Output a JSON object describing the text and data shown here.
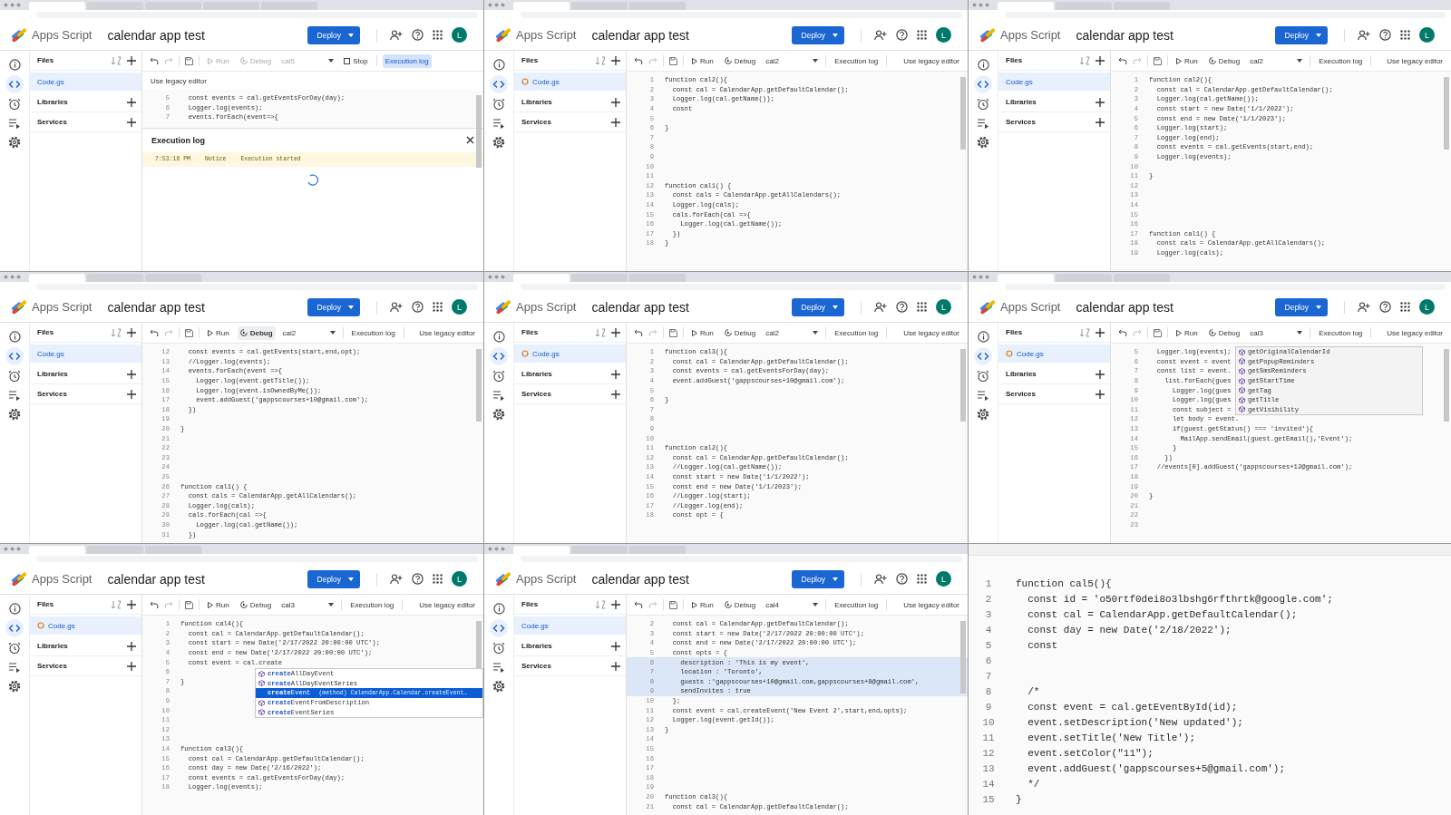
{
  "panels": [
    {
      "kind": "editor",
      "browser_tabs": [
        {
          "selected": true
        },
        {
          "selected": false
        },
        {
          "selected": false
        },
        {
          "selected": false
        },
        {
          "selected": false
        }
      ],
      "app_name": "Apps Script",
      "project": "calendar app test",
      "deploy": "Deploy",
      "avatar": "L",
      "files": {
        "title": "Files",
        "items": [
          {
            "name": "Code.gs",
            "selected": true,
            "unsaved": false
          }
        ],
        "sections": [
          "Libraries",
          "Services"
        ]
      },
      "toolbar": {
        "run": "Run",
        "run_disabled": true,
        "debug": "Debug",
        "debug_active": false,
        "function": "cal5",
        "stop": "Stop",
        "execution_log": "Execution log",
        "execution_log_selected": true,
        "legacy": "Use legacy editor"
      },
      "lines": [
        {
          "n": "5",
          "code": "  const events = cal.getEventsForDay(day);"
        },
        {
          "n": "6",
          "code": "  Logger.log(events);"
        },
        {
          "n": "7",
          "code": "  events.forEach(event=>{"
        }
      ],
      "exec_log": {
        "title": "Execution log",
        "rows": [
          {
            "time": "7:53:16 PM",
            "level": "Notice",
            "message": "Execution started"
          }
        ]
      }
    },
    {
      "kind": "editor",
      "browser_tabs": [
        {
          "selected": true
        },
        {
          "selected": false
        },
        {
          "selected": false
        }
      ],
      "app_name": "Apps Script",
      "project": "calendar app test",
      "deploy": "Deploy",
      "avatar": "L",
      "files": {
        "title": "Files",
        "items": [
          {
            "name": "Code.gs",
            "selected": true,
            "unsaved": true
          }
        ],
        "sections": [
          "Libraries",
          "Services"
        ]
      },
      "toolbar": {
        "run": "Run",
        "run_disabled": false,
        "debug": "Debug",
        "debug_active": false,
        "function": "cal2",
        "execution_log": "Execution log",
        "execution_log_selected": false,
        "legacy": "Use legacy editor"
      },
      "lines": [
        {
          "n": "1",
          "code": "function cal2(){"
        },
        {
          "n": "2",
          "code": "  const cal = CalendarApp.getDefaultCalendar();"
        },
        {
          "n": "3",
          "code": "  Logger.log(cal.getName());"
        },
        {
          "n": "4",
          "code": "  cosnt"
        },
        {
          "n": "5"
        },
        {
          "n": "6",
          "code": "}"
        },
        {
          "n": "7"
        },
        {
          "n": "8"
        },
        {
          "n": "9"
        },
        {
          "n": "10"
        },
        {
          "n": "11"
        },
        {
          "n": "12",
          "code": "function cal1() {"
        },
        {
          "n": "13",
          "code": "  const cals = CalendarApp.getAllCalendars();"
        },
        {
          "n": "14",
          "code": "  Logger.log(cals);"
        },
        {
          "n": "15",
          "code": "  cals.forEach(cal =>{"
        },
        {
          "n": "16",
          "code": "    Logger.log(cal.getName());"
        },
        {
          "n": "17",
          "code": "  })"
        },
        {
          "n": "18",
          "code": "}"
        }
      ]
    },
    {
      "kind": "editor",
      "browser_tabs": [
        {
          "selected": true
        },
        {
          "selected": false
        },
        {
          "selected": false
        }
      ],
      "app_name": "Apps Script",
      "project": "calendar app test",
      "deploy": "Deploy",
      "avatar": "L",
      "files": {
        "title": "Files",
        "items": [
          {
            "name": "Code.gs",
            "selected": true,
            "unsaved": false
          }
        ],
        "sections": [
          "Libraries",
          "Services"
        ]
      },
      "toolbar": {
        "run": "Run",
        "run_disabled": false,
        "debug": "Debug",
        "debug_active": false,
        "function": "cal2",
        "execution_log": "Execution log",
        "execution_log_selected": false,
        "legacy": "Use legacy editor"
      },
      "lines": [
        {
          "n": "1",
          "code": "function cal2(){"
        },
        {
          "n": "2",
          "code": "  const cal = CalendarApp.getDefaultCalendar();"
        },
        {
          "n": "3",
          "code": "  Logger.log(cal.getName());"
        },
        {
          "n": "4",
          "code": "  const start = new Date('1/1/2022');"
        },
        {
          "n": "5",
          "code": "  const end = new Date('1/1/2023');"
        },
        {
          "n": "6",
          "code": "  Logger.log(start);"
        },
        {
          "n": "7",
          "code": "  Logger.log(end);"
        },
        {
          "n": "8",
          "code": "  const events = cal.getEvents(start,end);"
        },
        {
          "n": "9",
          "code": "  Logger.log(events);"
        },
        {
          "n": "10"
        },
        {
          "n": "11",
          "code": "}"
        },
        {
          "n": "12"
        },
        {
          "n": "13"
        },
        {
          "n": "14"
        },
        {
          "n": "15"
        },
        {
          "n": "16"
        },
        {
          "n": "17",
          "code": "function cal1() {"
        },
        {
          "n": "18",
          "code": "  const cals = CalendarApp.getAllCalendars();"
        },
        {
          "n": "19",
          "code": "  Logger.log(cals);"
        }
      ]
    },
    {
      "kind": "editor",
      "browser_tabs": [
        {
          "selected": true
        },
        {
          "selected": false
        },
        {
          "selected": false
        }
      ],
      "app_name": "Apps Script",
      "project": "calendar app test",
      "deploy": "Deploy",
      "avatar": "L",
      "files": {
        "title": "Files",
        "items": [
          {
            "name": "Code.gs",
            "selected": true,
            "unsaved": false
          }
        ],
        "sections": [
          "Libraries",
          "Services"
        ]
      },
      "toolbar": {
        "run": "Run",
        "run_disabled": false,
        "debug": "Debug",
        "debug_active": true,
        "function": "cal2",
        "execution_log": "Execution log",
        "execution_log_selected": false,
        "legacy": "Use legacy editor"
      },
      "lines": [
        {
          "n": "12",
          "code": "  const events = cal.getEvents(start,end,opt);"
        },
        {
          "n": "13",
          "code": "  //Logger.log(events);"
        },
        {
          "n": "14",
          "code": "  events.forEach(event =>{"
        },
        {
          "n": "15",
          "code": "    Logger.log(event.getTitle());"
        },
        {
          "n": "16",
          "code": "    Logger.log(event.isOwnedByMe());"
        },
        {
          "n": "17",
          "code": "    event.addGuest('gappscourses+10@gmail.com');"
        },
        {
          "n": "18",
          "code": "  })"
        },
        {
          "n": "19"
        },
        {
          "n": "20",
          "code": "}"
        },
        {
          "n": "21"
        },
        {
          "n": "22"
        },
        {
          "n": "23"
        },
        {
          "n": "24"
        },
        {
          "n": "25"
        },
        {
          "n": "26",
          "code": "function cal1() {"
        },
        {
          "n": "27",
          "code": "  const cals = CalendarApp.getAllCalendars();"
        },
        {
          "n": "28",
          "code": "  Logger.log(cals);"
        },
        {
          "n": "29",
          "code": "  cals.forEach(cal =>{"
        },
        {
          "n": "30",
          "code": "    Logger.log(cal.getName());"
        },
        {
          "n": "31",
          "code": "  })"
        }
      ]
    },
    {
      "kind": "editor",
      "browser_tabs": [
        {
          "selected": true
        },
        {
          "selected": false
        },
        {
          "selected": false
        }
      ],
      "app_name": "Apps Script",
      "project": "calendar app test",
      "deploy": "Deploy",
      "avatar": "L",
      "files": {
        "title": "Files",
        "items": [
          {
            "name": "Code.gs",
            "selected": true,
            "unsaved": true
          }
        ],
        "sections": [
          "Libraries",
          "Services"
        ]
      },
      "toolbar": {
        "run": "Run",
        "run_disabled": false,
        "debug": "Debug",
        "debug_active": false,
        "function": "cal2",
        "execution_log": "Execution log",
        "execution_log_selected": false,
        "legacy": "Use legacy editor"
      },
      "lines": [
        {
          "n": "1",
          "code": "function cal3(){"
        },
        {
          "n": "2",
          "code": "  const cal = CalendarApp.getDefaultCalendar();"
        },
        {
          "n": "3",
          "code": "  const events = cal.getEventsForDay(day);"
        },
        {
          "n": "4",
          "code": "  event.addGuest('gappscourses+10@gmail.com');"
        },
        {
          "n": "5"
        },
        {
          "n": "6",
          "code": "}"
        },
        {
          "n": "7"
        },
        {
          "n": "8"
        },
        {
          "n": "9"
        },
        {
          "n": "10"
        },
        {
          "n": "11",
          "code": "function cal2(){"
        },
        {
          "n": "12",
          "code": "  const cal = CalendarApp.getDefaultCalendar();"
        },
        {
          "n": "13",
          "code": "  //Logger.log(cal.getName());"
        },
        {
          "n": "14",
          "code": "  const start = new Date('1/1/2022');"
        },
        {
          "n": "15",
          "code": "  const end = new Date('1/1/2023');"
        },
        {
          "n": "16",
          "code": "  //Logger.log(start);"
        },
        {
          "n": "17",
          "code": "  //Logger.log(end);"
        },
        {
          "n": "18",
          "code": "  const opt = {"
        }
      ]
    },
    {
      "kind": "editor",
      "browser_tabs": [
        {
          "selected": true
        },
        {
          "selected": false
        },
        {
          "selected": false
        }
      ],
      "app_name": "Apps Script",
      "project": "calendar app test",
      "deploy": "Deploy",
      "avatar": "L",
      "files": {
        "title": "Files",
        "items": [
          {
            "name": "Code.gs",
            "selected": true,
            "unsaved": true
          }
        ],
        "sections": [
          "Libraries",
          "Services"
        ]
      },
      "toolbar": {
        "run": "Run",
        "run_disabled": false,
        "debug": "Debug",
        "debug_active": false,
        "function": "cal3",
        "execution_log": "Execution log",
        "execution_log_selected": false,
        "legacy": "Use legacy editor"
      },
      "lines": [
        {
          "n": "5",
          "code": "  Logger.log(events);"
        },
        {
          "n": "6",
          "code": "  const event = event"
        },
        {
          "n": "7",
          "code": "  const list = event."
        },
        {
          "n": "8",
          "code": "    list.forEach(gues"
        },
        {
          "n": "9",
          "code": "      Logger.log(gues"
        },
        {
          "n": "10",
          "code": "      Logger.log(gues"
        },
        {
          "n": "11",
          "code": "      const subject ="
        },
        {
          "n": "12",
          "code": "      let body = event."
        },
        {
          "n": "13",
          "code": "      if(guest.getStatus() === 'invited'){"
        },
        {
          "n": "14",
          "code": "        MailApp.sendEmail(guest.getEmail(),'Event');"
        },
        {
          "n": "15",
          "code": "      }"
        },
        {
          "n": "16",
          "code": "    })"
        },
        {
          "n": "17",
          "code": "  //events[0].addGuest('gappscourses+12@gmail.com');"
        },
        {
          "n": "18"
        },
        {
          "n": "19"
        },
        {
          "n": "20",
          "code": "}"
        },
        {
          "n": "21"
        },
        {
          "n": "22"
        },
        {
          "n": "23"
        }
      ],
      "popup": {
        "kind": "members",
        "items": [
          {
            "label": "getOriginalCalendarId",
            "selected": false
          },
          {
            "label": "getPopupReminders",
            "selected": false
          },
          {
            "label": "getSmsReminders",
            "selected": false
          },
          {
            "label": "getStartTime",
            "selected": false
          },
          {
            "label": "getTag",
            "selected": false
          },
          {
            "label": "getTitle",
            "selected": false
          },
          {
            "label": "getVisibility",
            "selected": false
          }
        ]
      }
    },
    {
      "kind": "editor",
      "browser_tabs": [
        {
          "selected": true
        },
        {
          "selected": false
        },
        {
          "selected": false
        }
      ],
      "app_name": "Apps Script",
      "project": "calendar app test",
      "deploy": "Deploy",
      "avatar": "L",
      "files": {
        "title": "Files",
        "items": [
          {
            "name": "Code.gs",
            "selected": true,
            "unsaved": true
          }
        ],
        "sections": [
          "Libraries",
          "Services"
        ]
      },
      "toolbar": {
        "run": "Run",
        "run_disabled": false,
        "debug": "Debug",
        "debug_active": false,
        "function": "cal3",
        "execution_log": "Execution log",
        "execution_log_selected": false,
        "legacy": "Use legacy editor"
      },
      "lines": [
        {
          "n": "1",
          "code": "function cal4(){"
        },
        {
          "n": "2",
          "code": "  const cal = CalendarApp.getDefaultCalendar();"
        },
        {
          "n": "3",
          "code": "  const start = new Date('2/17/2022 20:00:00 UTC');"
        },
        {
          "n": "4",
          "code": "  const end = new Date('2/17/2022 20:00:00 UTC');"
        },
        {
          "n": "5",
          "code": "  const event = cal.create"
        },
        {
          "n": "6"
        },
        {
          "n": "7",
          "code": "}"
        },
        {
          "n": "8"
        },
        {
          "n": "9"
        },
        {
          "n": "10"
        },
        {
          "n": "11"
        },
        {
          "n": "12"
        },
        {
          "n": "13"
        },
        {
          "n": "14",
          "code": "function cal3(){"
        },
        {
          "n": "15",
          "code": "  const cal = CalendarApp.getDefaultCalendar();"
        },
        {
          "n": "16",
          "code": "  const day = new Date('2/16/2022');"
        },
        {
          "n": "17",
          "code": "  const events = cal.getEventsForDay(day);"
        },
        {
          "n": "18",
          "code": "  Logger.log(events);"
        }
      ],
      "popup": {
        "kind": "completions",
        "items": [
          {
            "label": "**create**AllDayEvent",
            "selected": false
          },
          {
            "label": "**create**AllDayEventSeries",
            "selected": false
          },
          {
            "label": "**create**Event",
            "selected": true,
            "detail": "(method) CalendarApp.Calendar.createEvent…"
          },
          {
            "label": "**create**EventFromDescription",
            "selected": false
          },
          {
            "label": "**create**EventSeries",
            "selected": false
          }
        ]
      }
    },
    {
      "kind": "editor",
      "browser_tabs": [
        {
          "selected": true
        },
        {
          "selected": false
        },
        {
          "selected": false
        }
      ],
      "app_name": "Apps Script",
      "project": "calendar app test",
      "deploy": "Deploy",
      "avatar": "L",
      "files": {
        "title": "Files",
        "items": [
          {
            "name": "Code.gs",
            "selected": true,
            "unsaved": false
          }
        ],
        "sections": [
          "Libraries",
          "Services"
        ]
      },
      "toolbar": {
        "run": "Run",
        "run_disabled": false,
        "debug": "Debug",
        "debug_active": false,
        "function": "cal4",
        "execution_log": "Execution log",
        "execution_log_selected": false,
        "legacy": "Use legacy editor"
      },
      "lines": [
        {
          "n": "2",
          "code": "  const cal = CalendarApp.getDefaultCalendar();",
          "selected": false
        },
        {
          "n": "3",
          "code": "  const start = new Date('2/17/2022 20:00:00 UTC');",
          "selected": false
        },
        {
          "n": "4",
          "code": "  const end = new Date('2/17/2022 20:00:00 UTC');",
          "selected": false
        },
        {
          "n": "5",
          "code": "  const opts = {",
          "selected": false
        },
        {
          "n": "6",
          "code": "    description : 'This is my event',",
          "selected": true
        },
        {
          "n": "7",
          "code": "    location : 'Toronto',",
          "selected": true
        },
        {
          "n": "8",
          "code": "    guests :'gappscourses+10@gmail.com,gappscourses+8@gmail.com',",
          "selected": true
        },
        {
          "n": "9",
          "code": "    sendInvites : true",
          "selected": true
        },
        {
          "n": "10",
          "code": "  };",
          "selected": false
        },
        {
          "n": "11",
          "code": "  const event = cal.createEvent('New Event 2',start,end,opts);",
          "selected": false
        },
        {
          "n": "12",
          "code": "  Logger.log(event.getId());",
          "selected": false
        },
        {
          "n": "13",
          "code": "}",
          "selected": false
        },
        {
          "n": "14",
          "selected": false
        },
        {
          "n": "15",
          "selected": false
        },
        {
          "n": "16",
          "selected": false
        },
        {
          "n": "17",
          "selected": false
        },
        {
          "n": "18",
          "selected": false
        },
        {
          "n": "19",
          "selected": false
        },
        {
          "n": "20",
          "code": "function cal3(){",
          "selected": false
        },
        {
          "n": "21",
          "code": "  const cal = CalendarApp.getDefaultCalendar();",
          "selected": false
        }
      ]
    },
    {
      "kind": "zoom",
      "lines": [
        {
          "n": "1",
          "code": "function cal5(){"
        },
        {
          "n": "2",
          "code": "  const id = 'o50rtf0dei8o3lbshg6rfthrtk@google.com';"
        },
        {
          "n": "3",
          "code": "  const cal = CalendarApp.getDefaultCalendar();"
        },
        {
          "n": "4",
          "code": "  const day = new Date('2/18/2022');"
        },
        {
          "n": "5",
          "code": "  const"
        },
        {
          "n": "6"
        },
        {
          "n": "7"
        },
        {
          "n": "8",
          "code": "  /*"
        },
        {
          "n": "9",
          "code": "  const event = cal.getEventById(id);"
        },
        {
          "n": "10",
          "code": "  event.setDescription('New updated');"
        },
        {
          "n": "11",
          "code": "  event.setTitle('New Title');"
        },
        {
          "n": "12",
          "code": "  event.setColor(\"11\");"
        },
        {
          "n": "13",
          "code": "  event.addGuest('gappscourses+5@gmail.com');"
        },
        {
          "n": "14",
          "code": "  */"
        },
        {
          "n": "15",
          "code": "}"
        }
      ]
    }
  ]
}
